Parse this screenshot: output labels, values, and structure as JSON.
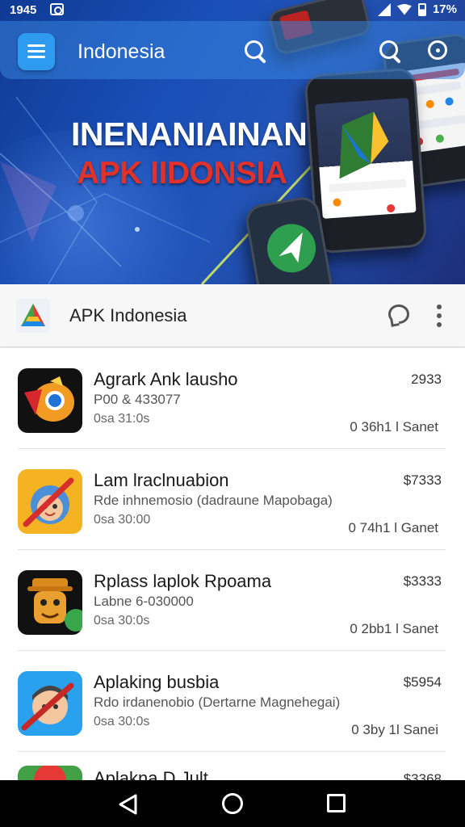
{
  "status_bar": {
    "time": "1945",
    "battery": "17%"
  },
  "toolbar": {
    "title": "Indonesia"
  },
  "hero": {
    "line1": "INENANIAINAN",
    "line2": "APK IIDONSIA"
  },
  "app_header": {
    "title": "APK Indonesia"
  },
  "list": {
    "items": [
      {
        "name": "Agrark Ank lausho",
        "sub": "P00 & 433077",
        "date": "0sa 31:0s",
        "price": "2933",
        "meta": "0 36h1 l Sanet"
      },
      {
        "name": "Lam lraclnuabion",
        "sub": "Rde inhnemosio (dadraune Mapobaga)",
        "date": "0sa 30:00",
        "price": "$7333",
        "meta": "0 74h1 l Ganet"
      },
      {
        "name": "Rplass laplok Rpoama",
        "sub": "Labne 6-030000",
        "date": "0sa 30:0s",
        "price": "$3333",
        "meta": "0 2bb1 l Sanet"
      },
      {
        "name": "Aplaking busbia",
        "sub": "Rdo irdanenobio (Dertarne Magnehegai)",
        "date": "0sa 30:0s",
        "price": "$5954",
        "meta": "0 3by 1l Sanei"
      },
      {
        "name": "Aplakna D Jult",
        "sub": "",
        "date": "",
        "price": "$3368",
        "meta": ""
      }
    ]
  },
  "colors": {
    "toolbar": "#2f9bf0",
    "headline_red": "#e0312b",
    "hero_blue": "#1a4fb8"
  }
}
